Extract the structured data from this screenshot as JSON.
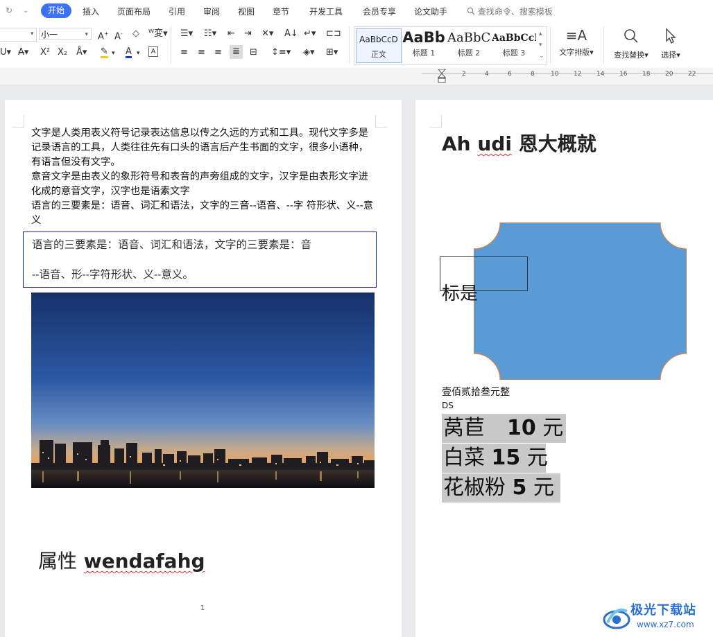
{
  "menu": {
    "tabs": [
      "开始",
      "插入",
      "页面布局",
      "引用",
      "审阅",
      "视图",
      "章节",
      "开发工具",
      "会员专享",
      "论文助手"
    ],
    "active_tab": "开始",
    "search_placeholder": "查找命令、搜索模板"
  },
  "ribbon": {
    "font_size": "小一",
    "styles": [
      {
        "preview": "AaBbCcD",
        "name": "正文"
      },
      {
        "preview": "AaBb",
        "name": "标题 1"
      },
      {
        "preview": "AaBbC",
        "name": "标题 2"
      },
      {
        "preview": "AaBbCcI",
        "name": "标题 3"
      }
    ],
    "text_layout": "文字排版",
    "find_replace": "查找替换",
    "select": "选择"
  },
  "ruler_ticks": [
    "2",
    "4",
    "6",
    "8",
    "10",
    "12",
    "14",
    "16",
    "18",
    "20",
    "22"
  ],
  "page1": {
    "paragraphs": [
      "文字是人类用表义符号记录表达信息以传之久远的方式和工具。现代文字多是记录语言的工具，人类往往先有口头的语言后产生书面的文字，很多小语种，有语言但没有文字。",
      "意音文字是由表义的象形符号和表音的声旁组成的文字，汉字是由表形文字进化成的意音文字，汉字也是语素文字",
      "语言的三要素是：语音、词汇和语法，文字的三音--语音、--字  符形状、义--意义"
    ],
    "textbox": {
      "line1": "语言的三要素是：语音、词汇和语法，文字的三要素是：音",
      "line2": "--语音、形--字符形状、义--意义。"
    },
    "title_cn": "属性",
    "title_en": "wendafahg",
    "page_number": "1"
  },
  "page2": {
    "title_en": "Ah",
    "title_en2": "udi",
    "title_cn": "恩大概就",
    "shape_label": "标是",
    "caption": "壹佰贰拾叁元整",
    "ds": "DS",
    "prices": [
      {
        "item": "莴苣",
        "amount": "10",
        "unit": "元"
      },
      {
        "item": "白菜",
        "amount": "15",
        "unit": "元"
      },
      {
        "item": "花椒粉",
        "amount": "5",
        "unit": "元"
      }
    ]
  },
  "watermark": {
    "name": "极光下载站",
    "url": "www.xz7.com"
  },
  "colors": {
    "accent": "#3a73f5",
    "shape_fill": "#5b9bd5",
    "shape_stroke": "#ed7d31",
    "highlight": "#c8c8c8"
  }
}
